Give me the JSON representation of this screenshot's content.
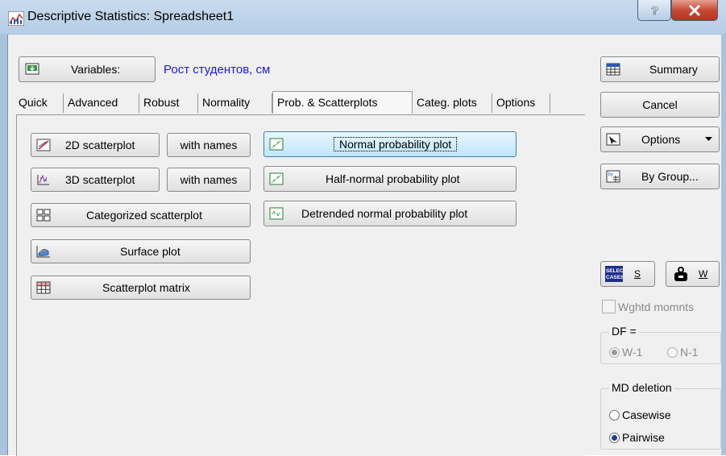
{
  "window": {
    "title": "Descriptive Statistics: Spreadsheet1"
  },
  "variables": {
    "button_label": "Variables:",
    "value": "Рост студентов, см"
  },
  "tabs": [
    {
      "label": "Quick"
    },
    {
      "label": "Advanced"
    },
    {
      "label": "Robust"
    },
    {
      "label": "Normality"
    },
    {
      "label": "Prob. & Scatterplots",
      "active": true
    },
    {
      "label": "Categ. plots"
    },
    {
      "label": "Options"
    }
  ],
  "left_buttons": {
    "scatter2d": "2D scatterplot",
    "with_names_1": "with names",
    "scatter3d": "3D scatterplot",
    "with_names_2": "with names",
    "categorized": "Categorized scatterplot",
    "surface": "Surface plot",
    "matrix": "Scatterplot matrix"
  },
  "mid_buttons": {
    "normal": "Normal probability plot",
    "half_normal": "Half-normal probability plot",
    "detrended": "Detrended normal probability plot"
  },
  "right_panel": {
    "summary": "Summary",
    "cancel": "Cancel",
    "options": "Options",
    "by_group": "By Group...",
    "select_cases_icon_text": "SELECT CASES",
    "select_cases_letter": "S",
    "weight_letter": "W",
    "wghtd_momnts": "Wghtd momnts",
    "df_title": "DF =",
    "df_w1": "W-1",
    "df_n1": "N-1",
    "md_title": "MD deletion",
    "casewise": "Casewise",
    "pairwise": "Pairwise"
  }
}
